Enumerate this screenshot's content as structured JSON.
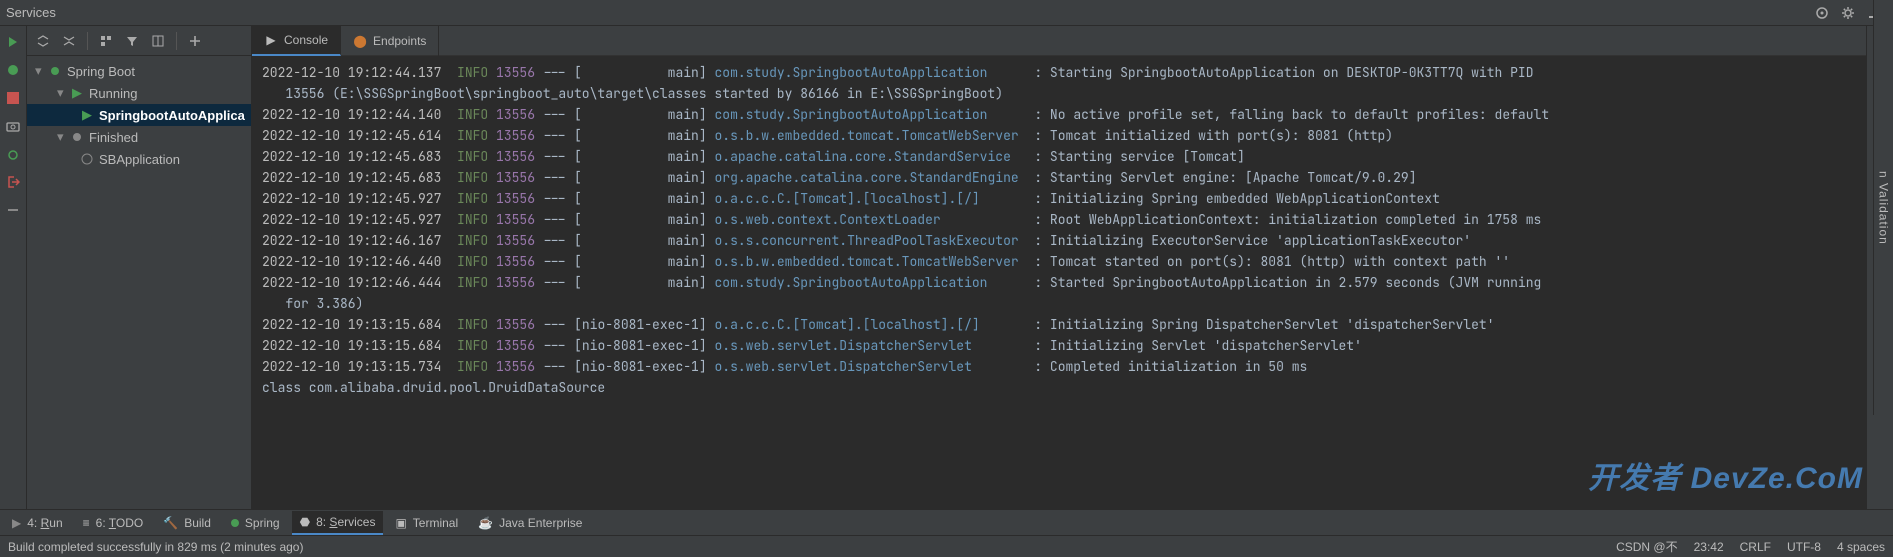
{
  "header": {
    "title": "Services"
  },
  "right_edge_label": "n Validation",
  "tree": {
    "root": "Spring Boot",
    "running": "Running",
    "app_running": "SpringbootAutoApplica",
    "finished": "Finished",
    "app_finished": "SBApplication"
  },
  "tabs": {
    "console": "Console",
    "endpoints": "Endpoints"
  },
  "log_lines": [
    {
      "ts": "2022-12-10 19:12:44.137",
      "lvl": "INFO",
      "pid": "13556",
      "thread": "[           main]",
      "logger": "com.study.SpringbootAutoApplication",
      "pad": "    ",
      "msg": ": Starting SpringbootAutoApplication on DESKTOP-0K3TT7Q with PID"
    },
    {
      "cont": "   13556 (E:\\SSGSpringBoot\\springboot_auto\\target\\classes started by 86166 in E:\\SSGSpringBoot)"
    },
    {
      "ts": "2022-12-10 19:12:44.140",
      "lvl": "INFO",
      "pid": "13556",
      "thread": "[           main]",
      "logger": "com.study.SpringbootAutoApplication",
      "pad": "    ",
      "msg": ": No active profile set, falling back to default profiles: default"
    },
    {
      "ts": "2022-12-10 19:12:45.614",
      "lvl": "INFO",
      "pid": "13556",
      "thread": "[           main]",
      "logger": "o.s.b.w.embedded.tomcat.TomcatWebServer",
      "pad": "",
      "msg": ": Tomcat initialized with port(s): 8081 (http)"
    },
    {
      "ts": "2022-12-10 19:12:45.683",
      "lvl": "INFO",
      "pid": "13556",
      "thread": "[           main]",
      "logger": "o.apache.catalina.core.StandardService",
      "pad": " ",
      "msg": ": Starting service [Tomcat]"
    },
    {
      "ts": "2022-12-10 19:12:45.683",
      "lvl": "INFO",
      "pid": "13556",
      "thread": "[           main]",
      "logger": "org.apache.catalina.core.StandardEngine",
      "pad": "",
      "msg": ": Starting Servlet engine: [Apache Tomcat/9.0.29]"
    },
    {
      "ts": "2022-12-10 19:12:45.927",
      "lvl": "INFO",
      "pid": "13556",
      "thread": "[           main]",
      "logger": "o.a.c.c.C.[Tomcat].[localhost].[/]",
      "pad": "     ",
      "msg": ": Initializing Spring embedded WebApplicationContext"
    },
    {
      "ts": "2022-12-10 19:12:45.927",
      "lvl": "INFO",
      "pid": "13556",
      "thread": "[           main]",
      "logger": "o.s.web.context.ContextLoader",
      "pad": "          ",
      "msg": ": Root WebApplicationContext: initialization completed in 1758 ms"
    },
    {
      "ts": "2022-12-10 19:12:46.167",
      "lvl": "INFO",
      "pid": "13556",
      "thread": "[           main]",
      "logger": "o.s.s.concurrent.ThreadPoolTaskExecutor",
      "pad": "",
      "msg": ": Initializing ExecutorService 'applicationTaskExecutor'"
    },
    {
      "ts": "2022-12-10 19:12:46.440",
      "lvl": "INFO",
      "pid": "13556",
      "thread": "[           main]",
      "logger": "o.s.b.w.embedded.tomcat.TomcatWebServer",
      "pad": "",
      "msg": ": Tomcat started on port(s): 8081 (http) with context path ''"
    },
    {
      "ts": "2022-12-10 19:12:46.444",
      "lvl": "INFO",
      "pid": "13556",
      "thread": "[           main]",
      "logger": "com.study.SpringbootAutoApplication",
      "pad": "    ",
      "msg": ": Started SpringbootAutoApplication in 2.579 seconds (JVM running"
    },
    {
      "cont": "   for 3.386)"
    },
    {
      "ts": "2022-12-10 19:13:15.684",
      "lvl": "INFO",
      "pid": "13556",
      "thread": "[nio-8081-exec-1]",
      "logger": "o.a.c.c.C.[Tomcat].[localhost].[/]",
      "pad": "     ",
      "msg": ": Initializing Spring DispatcherServlet 'dispatcherServlet'"
    },
    {
      "ts": "2022-12-10 19:13:15.684",
      "lvl": "INFO",
      "pid": "13556",
      "thread": "[nio-8081-exec-1]",
      "logger": "o.s.web.servlet.DispatcherServlet",
      "pad": "      ",
      "msg": ": Initializing Servlet 'dispatcherServlet'"
    },
    {
      "ts": "2022-12-10 19:13:15.734",
      "lvl": "INFO",
      "pid": "13556",
      "thread": "[nio-8081-exec-1]",
      "logger": "o.s.web.servlet.DispatcherServlet",
      "pad": "      ",
      "msg": ": Completed initialization in 50 ms"
    },
    {
      "plain": "class com.alibaba.druid.pool.DruidDataSource"
    }
  ],
  "bottom_tabs": {
    "run": {
      "num": "4",
      "u": "R",
      "rest": "un",
      "label": ": "
    },
    "todo": {
      "num": "6",
      "u": "T",
      "rest": "ODO",
      "label": ": "
    },
    "build": "Build",
    "spring": "Spring",
    "services": {
      "num": "8",
      "u": "S",
      "rest": "ervices",
      "label": ": "
    },
    "terminal": "Terminal",
    "java_ee": "Java Enterprise"
  },
  "status": {
    "msg": "Build completed successfully in 829 ms (2 minutes ago)",
    "csdn": "CSDN @不",
    "pos": "23:42",
    "crlf": "CRLF",
    "enc": "UTF-8",
    "indent": "4 spaces"
  },
  "watermark": "开发者\nDevZe.CoM"
}
